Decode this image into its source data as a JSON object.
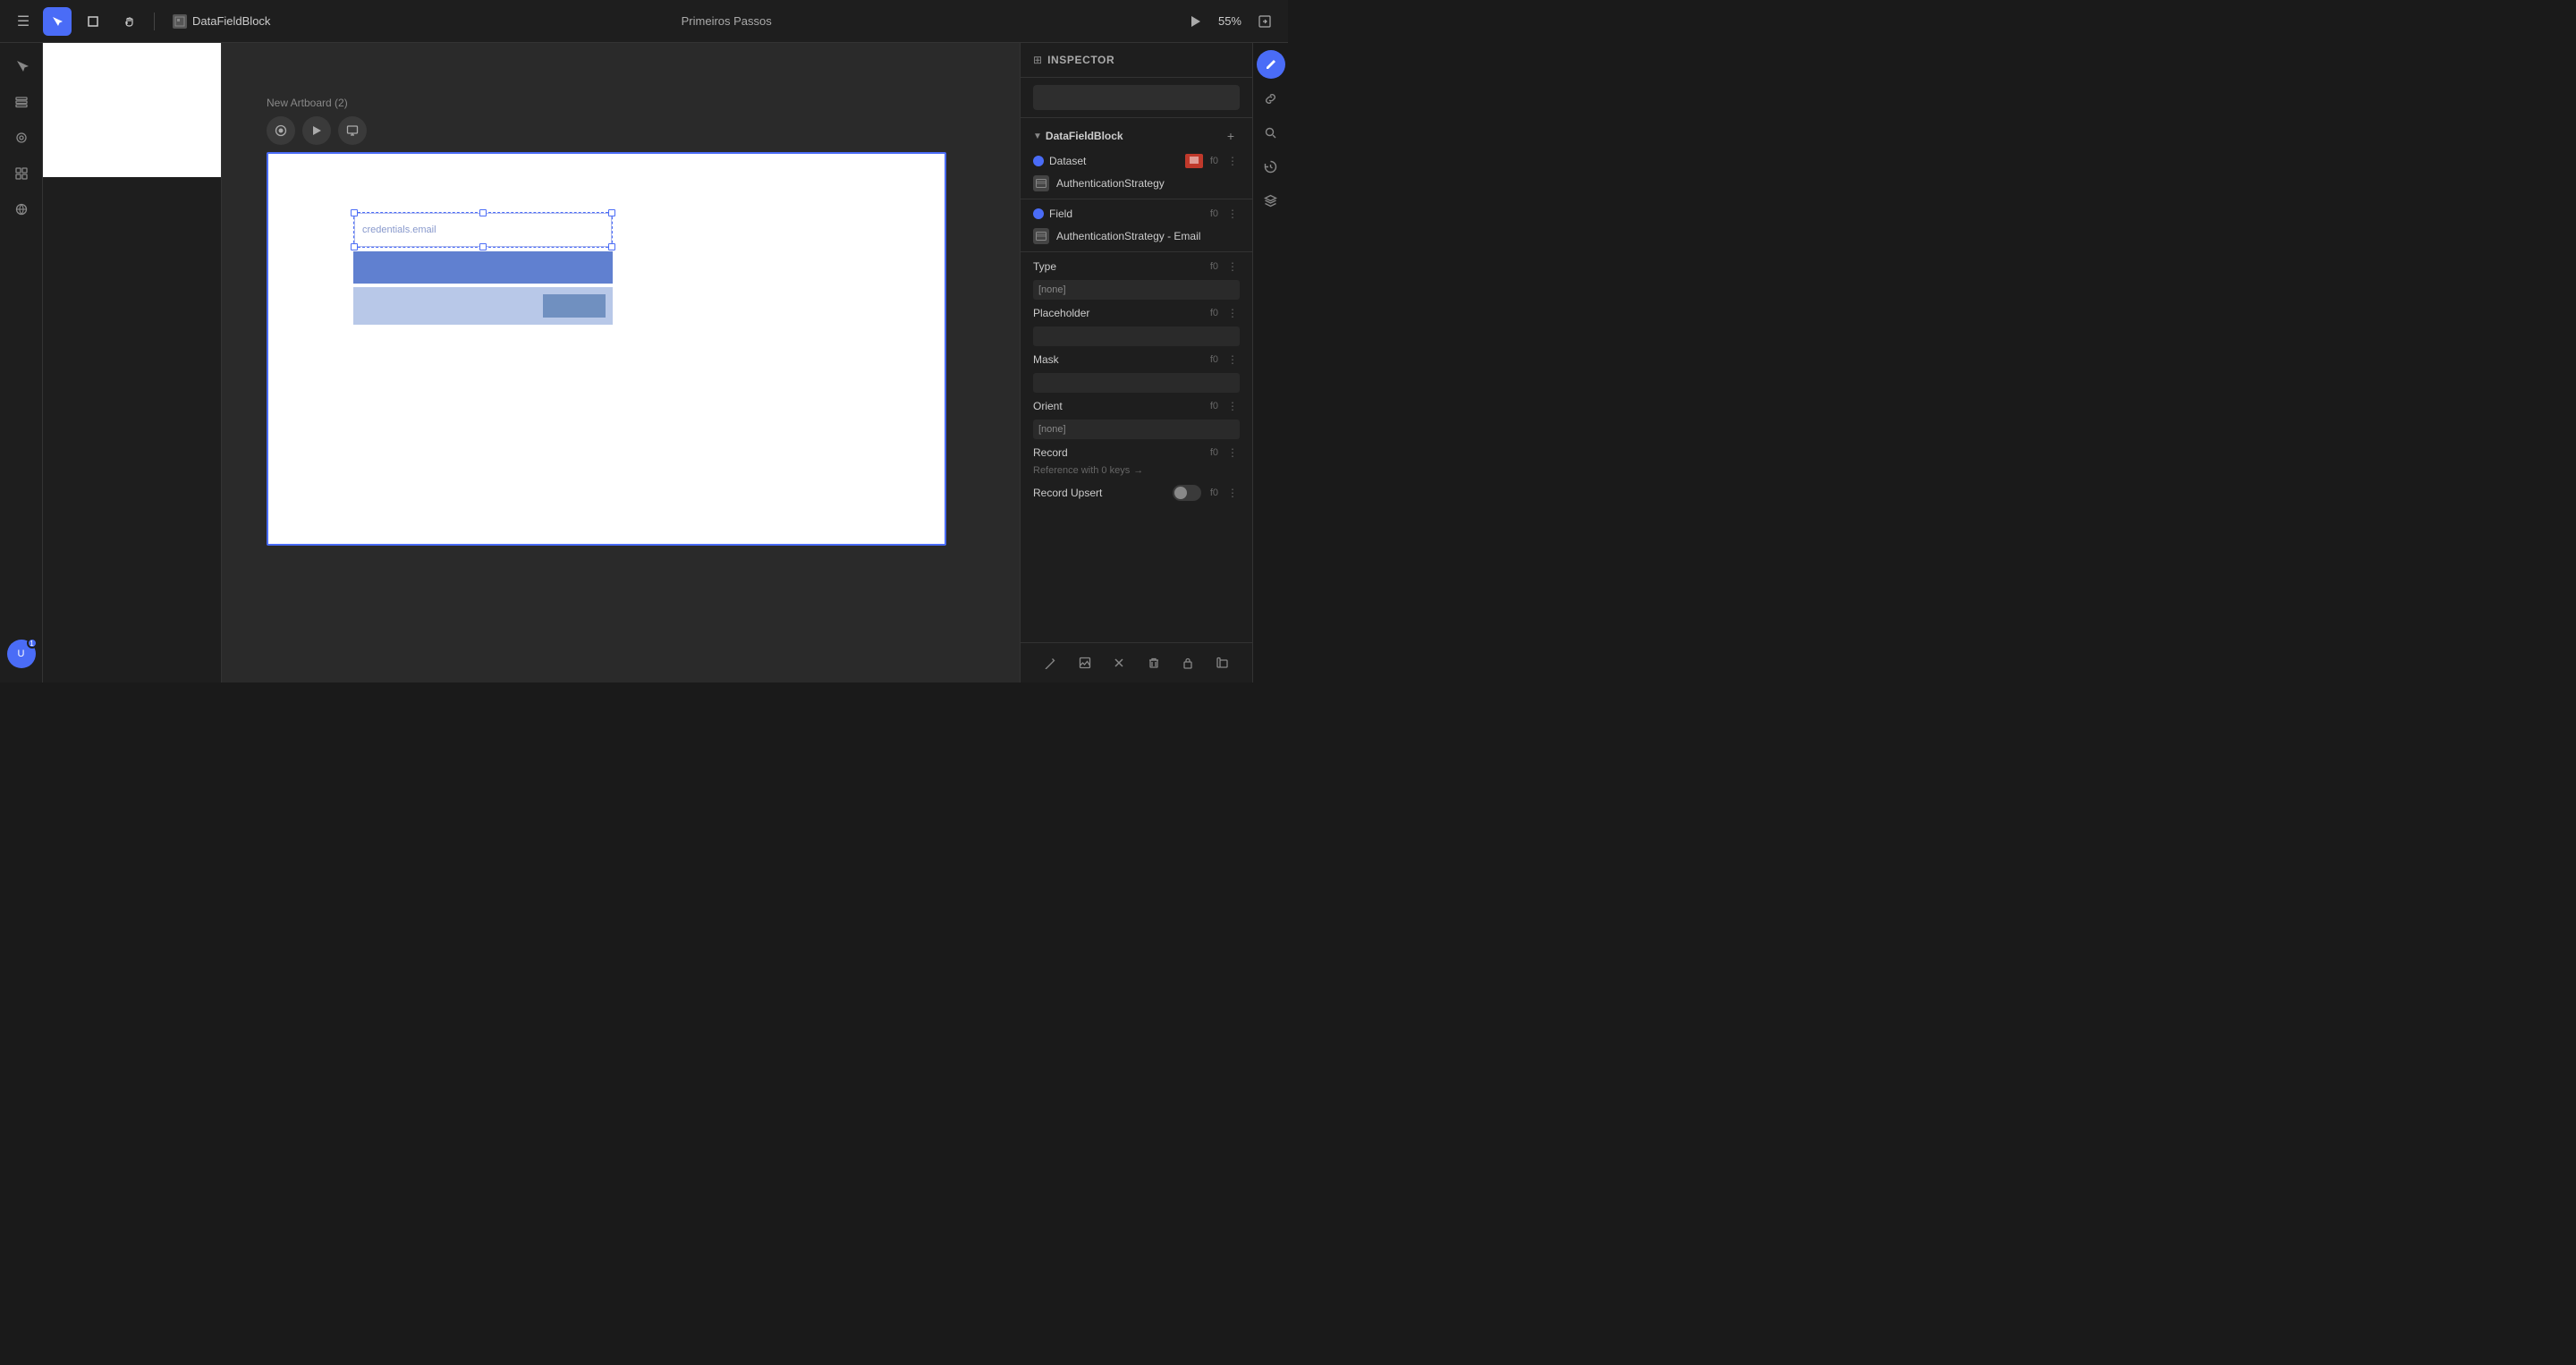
{
  "topbar": {
    "menu_icon": "☰",
    "tools": [
      {
        "id": "select",
        "icon": "▲",
        "active": true
      },
      {
        "id": "crop",
        "icon": "⊡",
        "active": false
      },
      {
        "id": "hand",
        "icon": "✋",
        "active": false
      }
    ],
    "filename_icon": "⊞",
    "filename": "DataFieldBlock",
    "title": "Primeiros Passos",
    "play_icon": "▶",
    "zoom": "55%",
    "share_icon": "⇪"
  },
  "sidebar": {
    "items": [
      {
        "id": "cursor",
        "icon": "▲",
        "active": false
      },
      {
        "id": "layers",
        "icon": "⊟",
        "active": false
      },
      {
        "id": "components",
        "icon": "◎",
        "active": false
      },
      {
        "id": "grid",
        "icon": "⊞",
        "active": false
      },
      {
        "id": "globe",
        "icon": "⊕",
        "active": false
      }
    ],
    "avatar_text": "U",
    "avatar_badge": "1"
  },
  "artboard": {
    "label": "New Artboard (2)",
    "controls": [
      {
        "id": "preview",
        "icon": "◉"
      },
      {
        "id": "play",
        "icon": "▶"
      },
      {
        "id": "screen",
        "icon": "□"
      }
    ]
  },
  "canvas": {
    "selected_text": "credentials.email"
  },
  "inspector": {
    "title": "INSPECTOR",
    "section_title": "DataFieldBlock",
    "add_icon": "+",
    "dataset_label": "Dataset",
    "dataset_f0": "f0",
    "authentication_strategy": "AuthenticationStrategy",
    "field_label": "Field",
    "field_f0": "f0",
    "authentication_strategy_email": "AuthenticationStrategy - Email",
    "type_label": "Type",
    "type_f0": "f0",
    "type_value": "[none]",
    "placeholder_label": "Placeholder",
    "placeholder_f0": "f0",
    "placeholder_value": "",
    "mask_label": "Mask",
    "mask_f0": "f0",
    "mask_value": "",
    "orient_label": "Orient",
    "orient_f0": "f0",
    "orient_value": "[none]",
    "record_label": "Record",
    "record_f0": "f0",
    "record_ref_text": "Reference with 0 keys",
    "record_ref_arrow": "→",
    "record_upsert_label": "Record Upsert",
    "record_upsert_f0": "f0",
    "bottom_tools": [
      {
        "id": "edit",
        "icon": "✏"
      },
      {
        "id": "image",
        "icon": "⊞"
      },
      {
        "id": "close",
        "icon": "✕"
      },
      {
        "id": "trash",
        "icon": "🗑"
      },
      {
        "id": "lock",
        "icon": "🔒"
      },
      {
        "id": "copy",
        "icon": "⊟"
      }
    ]
  },
  "far_right": {
    "buttons": [
      {
        "id": "edit-pencil",
        "icon": "✎",
        "accent": true
      },
      {
        "id": "link",
        "icon": "🔗",
        "accent": false
      },
      {
        "id": "search",
        "icon": "🔍",
        "accent": false
      },
      {
        "id": "history",
        "icon": "⟳",
        "accent": false
      },
      {
        "id": "layers-alt",
        "icon": "⊟",
        "accent": false
      }
    ]
  }
}
